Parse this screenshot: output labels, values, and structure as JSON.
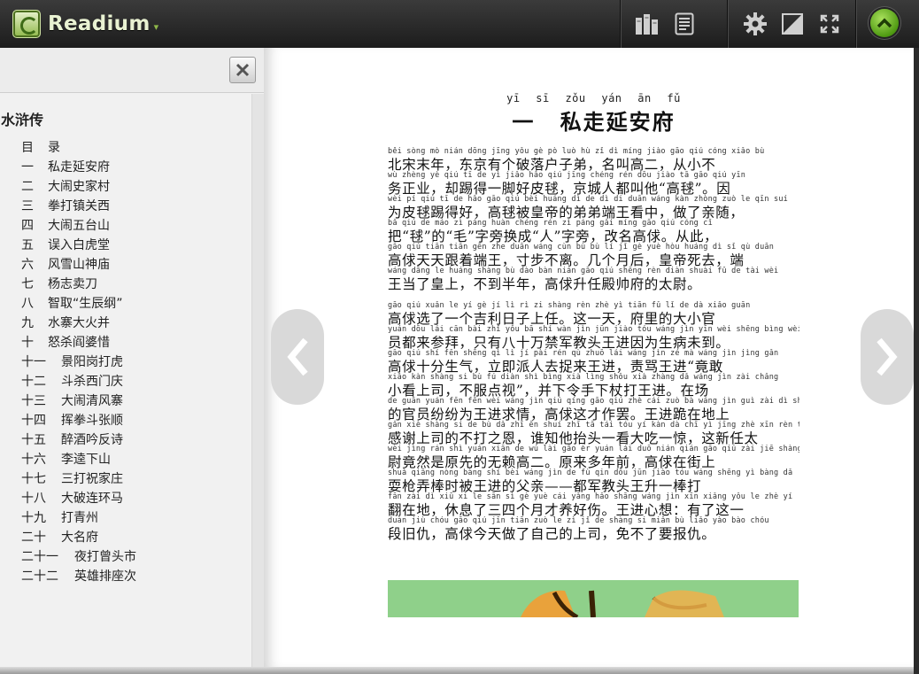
{
  "app": {
    "name": "Readium"
  },
  "colors": {
    "accent_green": "#6cb82c",
    "toolbar_bg": "#2a2a2a",
    "page_bg": "#ffffff"
  },
  "toolbar": {
    "icons": [
      "library-icon",
      "toc-icon",
      "gear-icon",
      "contrast-icon",
      "fullscreen-icon",
      "scroll-up-icon"
    ]
  },
  "sidebar": {
    "book_title": "水浒传",
    "toc": [
      {
        "num": "目",
        "label": "录"
      },
      {
        "num": "一",
        "label": "私走延安府"
      },
      {
        "num": "二",
        "label": "大闹史家村"
      },
      {
        "num": "三",
        "label": "拳打镇关西"
      },
      {
        "num": "四",
        "label": "大闹五台山"
      },
      {
        "num": "五",
        "label": "误入白虎堂"
      },
      {
        "num": "六",
        "label": "风雪山神庙"
      },
      {
        "num": "七",
        "label": "杨志卖刀"
      },
      {
        "num": "八",
        "label": "智取“生辰纲”"
      },
      {
        "num": "九",
        "label": "水寨大火并"
      },
      {
        "num": "十",
        "label": "怒杀阎婆惜"
      },
      {
        "num": "十一",
        "label": "景阳岗打虎"
      },
      {
        "num": "十二",
        "label": "斗杀西门庆"
      },
      {
        "num": "十三",
        "label": "大闹清风寨"
      },
      {
        "num": "十四",
        "label": "挥拳斗张顺"
      },
      {
        "num": "十五",
        "label": "醉酒吟反诗"
      },
      {
        "num": "十六",
        "label": "李逵下山"
      },
      {
        "num": "十七",
        "label": "三打祝家庄"
      },
      {
        "num": "十八",
        "label": "大破连环马"
      },
      {
        "num": "十九",
        "label": "打青州"
      },
      {
        "num": "二十",
        "label": "大名府"
      },
      {
        "num": "二十一",
        "label": "夜打曾头市"
      },
      {
        "num": "二十二",
        "label": "英雄排座次"
      }
    ]
  },
  "chapter": {
    "title_pinyin": "yī sī zǒu yán ān fǔ",
    "title": "一 私走延安府",
    "paragraphs": [
      [
        {
          "py": "      běi sòng mò nián  dōng jīng yǒu gè pò luò hù  zǐ dì   míng jiào gāo qiú   cóng xiǎo bù",
          "hz": "   北宋末年，东京有个破落户子弟，名叫高二，从小不"
        },
        {
          "py": "wù zhèng yè    qiú tī de yì jiǎo hǎo qiú   jīng chéng rén dōu jiào tā   gāo qiú      yīn",
          "hz": "务正业，却踢得一脚好皮毬，京城人都叫他“高毬”。因"
        },
        {
          "py": "wèi pí qiú tī de hǎo   gāo qiú bèi huáng dì de dì di duān wáng kàn zhòng  zuò le qīn suí",
          "hz": "为皮毬踢得好，高毬被皇帝的弟弟端王看中，做了亲随，"
        },
        {
          "py": " bǎ   qiú   de   máo   zì páng huàn chéng  rén    zì páng  gǎi míng gāo qiú   cóng cǐ",
          "hz": "把“毬”的“毛”字旁换成“人”字旁，改名高俅。从此，"
        },
        {
          "py": "gāo qiú tiān tiān gēn zhe duān wáng  cùn bù bù lí    jǐ gè yuè hòu  huáng dì sǐ qù   duān",
          "hz": "高俅天天跟着端王，寸步不离。几个月后，皇帝死去，端"
        },
        {
          "py": "wáng dāng le huáng shàng  bù dào bàn nián   gāo qiú shēng rèn diàn shuài fǔ de tài wèi",
          "hz": "王当了皇上，不到半年，高俅升任殿帅府的太尉。"
        }
      ],
      [
        {
          "py": "      gāo qiú xuǎn le yí gè jí lì rì zi shàng rèn   zhè yì tiān   fǔ lǐ de dà xiǎo guān",
          "hz": "   高俅选了一个吉利日子上任。这一天，府里的大小官"
        },
        {
          "py": "yuán dōu lái cān bài   zhǐ yǒu bā shí wàn jìn jūn jiào tóu wáng jìn yīn wèi shēng bìng wèi dào",
          "hz": "员都来参拜，只有八十万禁军教头王进因为生病未到。"
        },
        {
          "py": "gāo qiú shí fēn shēng qì    lì jí pài rén qù zhuō lái wáng jìn    zé mà wáng jìn   jìng gǎn",
          "hz": "高俅十分生气，立即派人去捉来王进，责骂王进“竟敢"
        },
        {
          "py": "xiǎo kàn shàng si   bù fú diàn shì    bìng xià lìng shǒu xià zhàng dǎ wáng jìn   zài chǎng",
          "hz": "小看上司，不服点视”，并下令手下杖打王进。在场"
        },
        {
          "py": "de guān yuán fēn fēn wèi wáng jìn qiú qíng   gāo qiú zhè cái zuò bà   wáng jìn guì zài dì shàng",
          "hz": "的官员纷纷为王进求情，高俅这才作罢。王进跪在地上"
        },
        {
          "py": "gǎn xiè shàng si de bù dǎ zhī ēn   shuí zhī tā tái tóu yí kàn dà chī yì jīng   zhè xīn rèn tài",
          "hz": "感谢上司的不打之恩，谁知他抬头一看大吃一惊，这新任太"
        },
        {
          "py": "wèi jìng rán shì yuán xiān de wú lài gāo èr   yuán lái duō nián qián   gāo qiú zài jiē shàng",
          "hz": "尉竟然是原先的无赖高二。原来多年前，高俅在街上"
        },
        {
          "py": "shuǎ qiāng nòng bàng shí bèi wáng jìn de fù qin    dōu jūn jiào tóu wáng shēng yì bàng dǎ",
          "hz": "耍枪弄棒时被王进的父亲——都军教头王升一棒打"
        },
        {
          "py": "fān zài dì   xiū xi le sān sì gè yuè cái yǎng hǎo shāng  wáng jìn xīn xiǎng  yǒu le zhè yí",
          "hz": "翻在地，休息了三四个月才养好伤。王进心想：有了这一"
        },
        {
          "py": "duàn jiù chóu   gāo qiú jīn tiān zuò le zì jǐ de shàng si   miǎn bù liǎo yào bào chóu",
          "hz": "段旧仇，高俅今天做了自己的上司，免不了要报仇。"
        }
      ]
    ]
  }
}
